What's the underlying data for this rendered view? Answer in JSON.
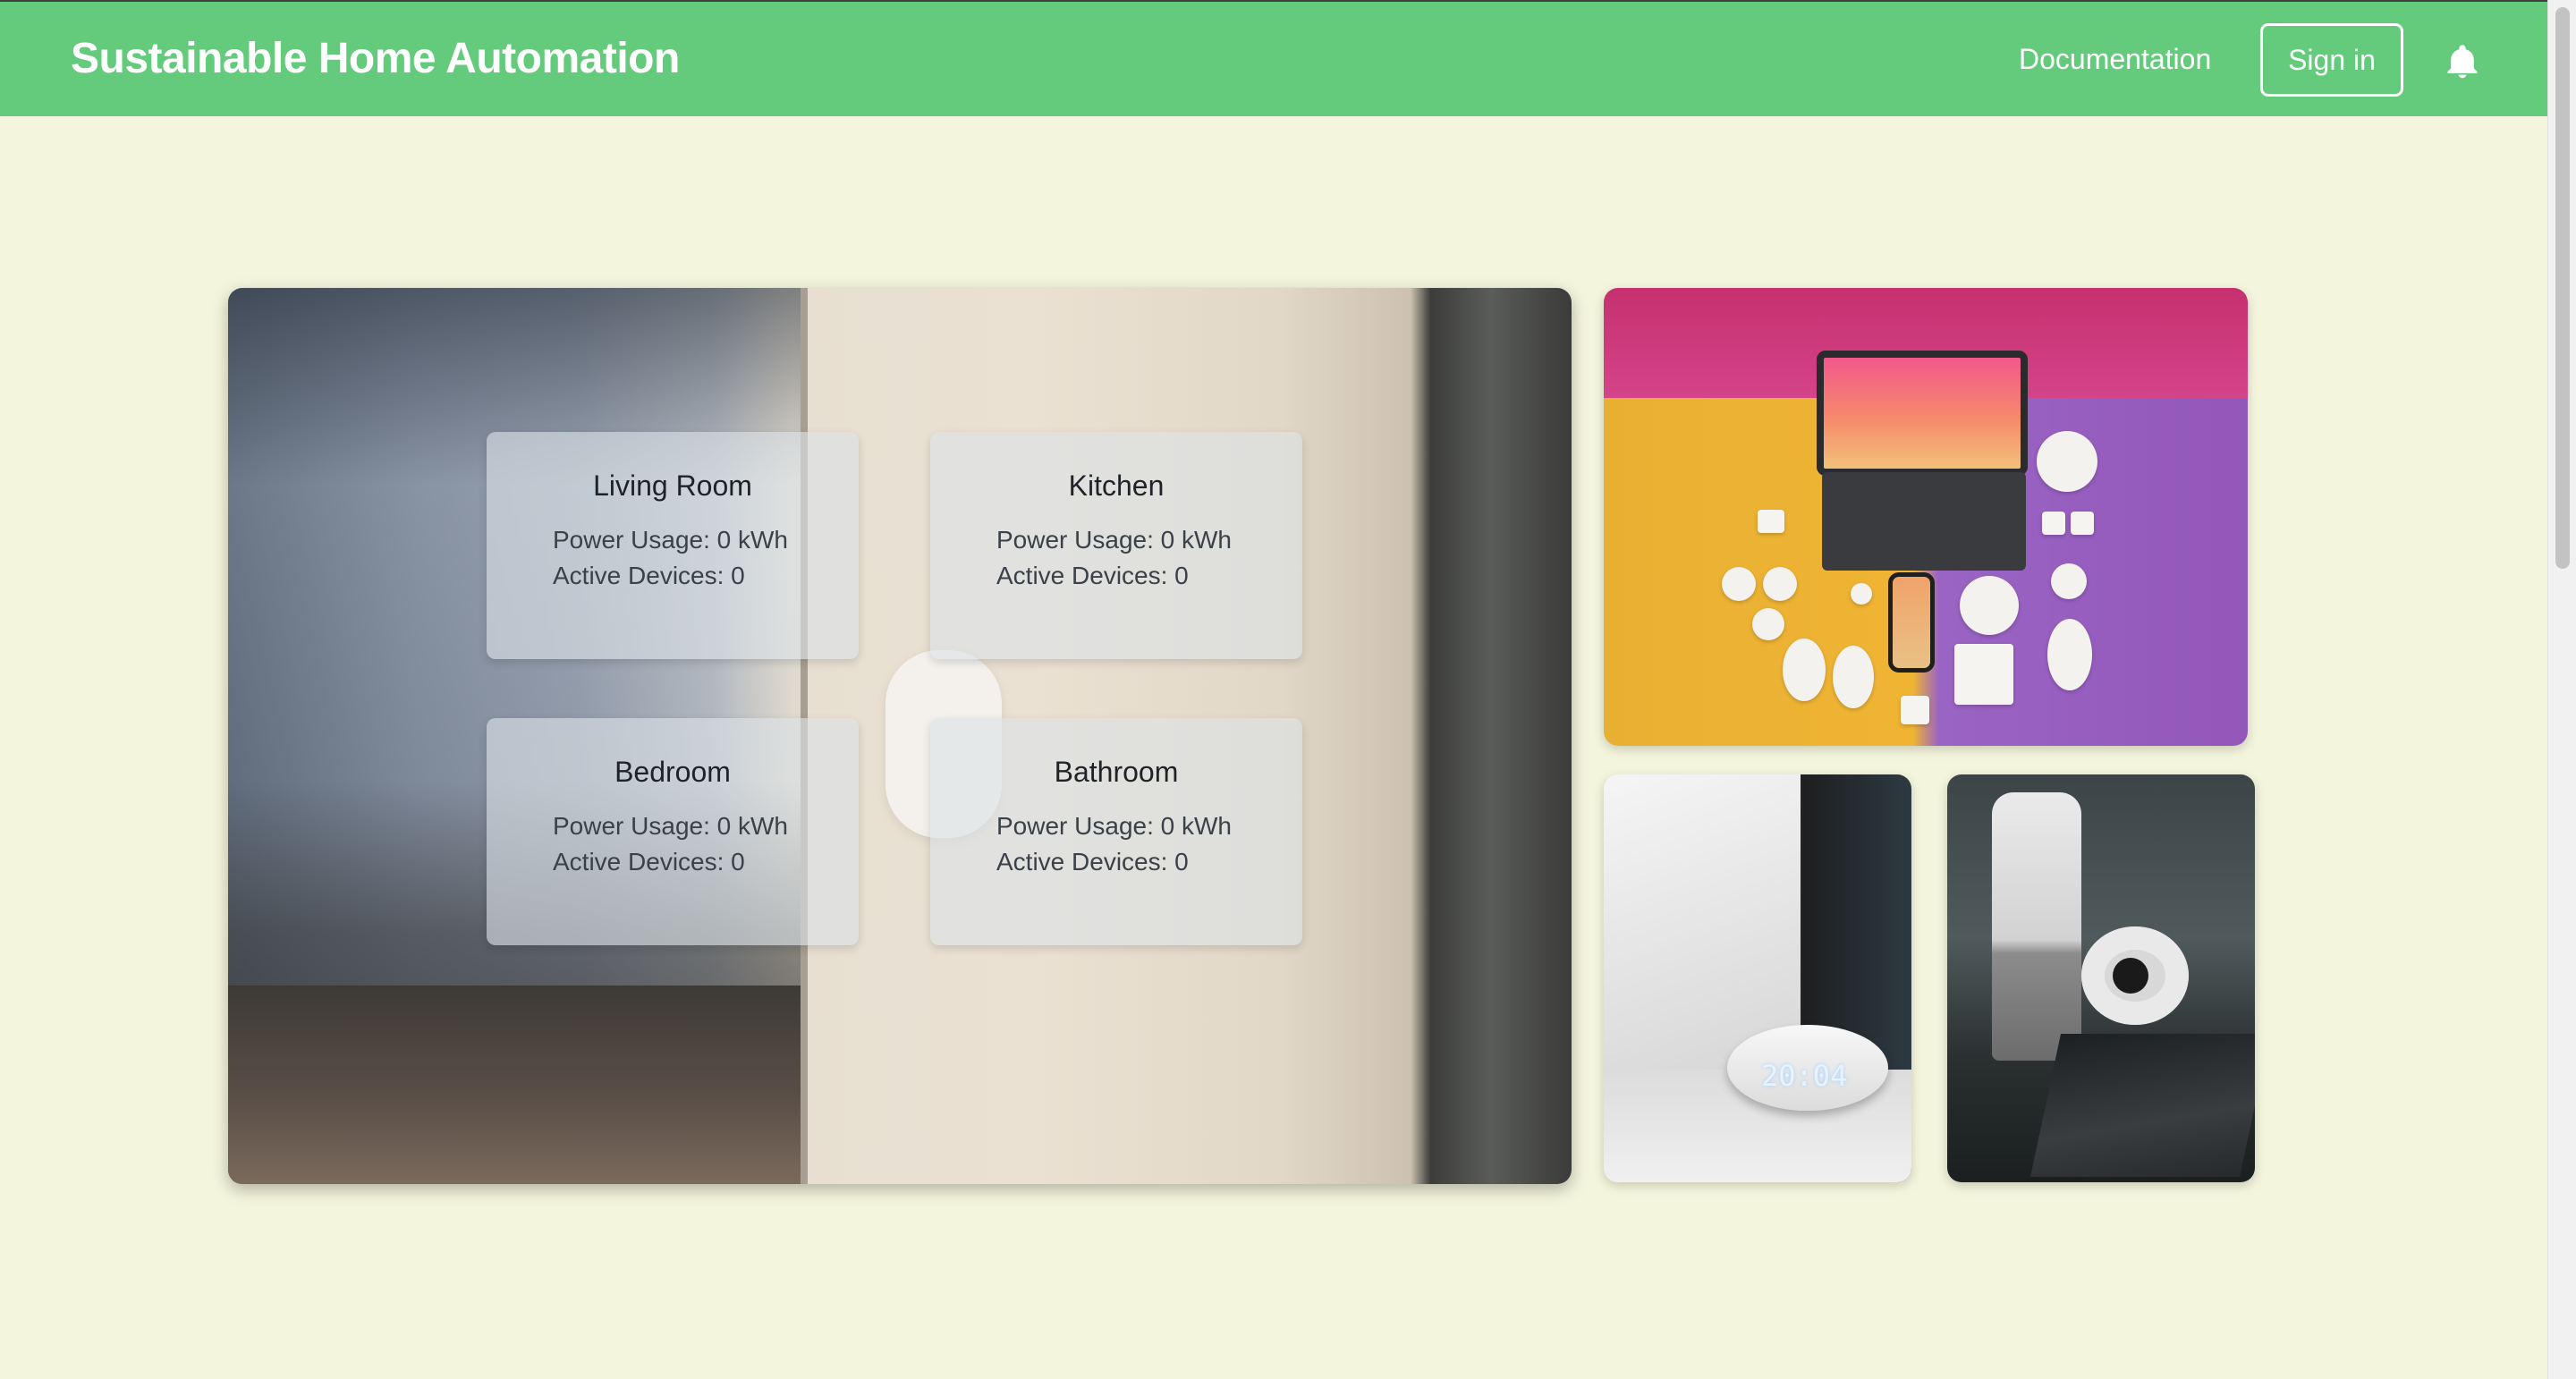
{
  "header": {
    "brand": "Sustainable Home Automation",
    "nav": {
      "documentation_label": "Documentation",
      "sign_in_label": "Sign in",
      "notifications_icon": "bell-icon"
    }
  },
  "rooms": [
    {
      "name": "Living Room",
      "power_usage": "Power Usage: 0 kWh",
      "active_devices": "Active Devices: 0"
    },
    {
      "name": "Kitchen",
      "power_usage": "Power Usage: 0 kWh",
      "active_devices": "Active Devices: 0"
    },
    {
      "name": "Bedroom",
      "power_usage": "Power Usage: 0 kWh",
      "active_devices": "Active Devices: 0"
    },
    {
      "name": "Bathroom",
      "power_usage": "Power Usage: 0 kWh",
      "active_devices": "Active Devices: 0"
    }
  ],
  "gallery": {
    "echo_clock": "20:04"
  },
  "colors": {
    "header_green": "#65cb7c",
    "page_background": "#f4f5dd"
  }
}
